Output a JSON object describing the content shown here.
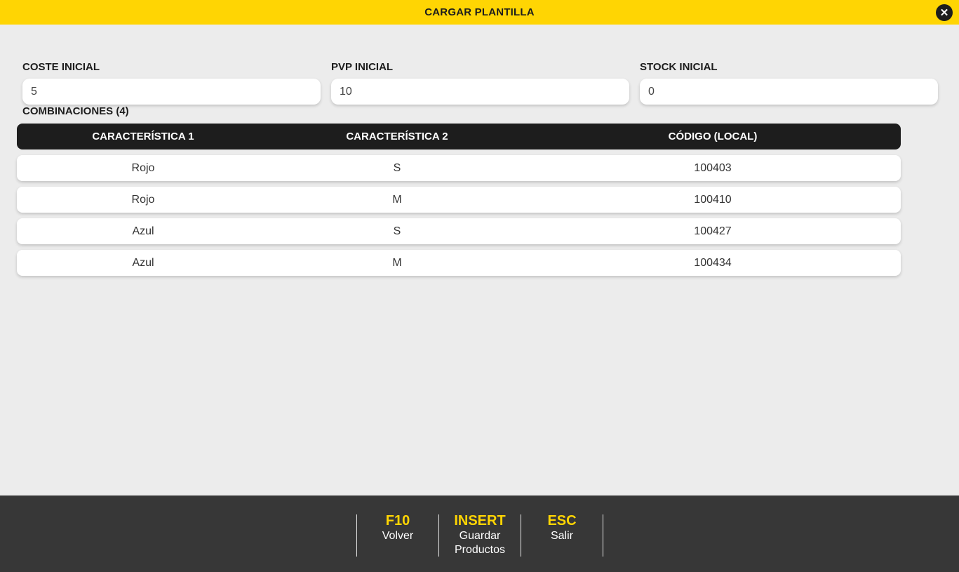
{
  "header": {
    "title": "CARGAR PLANTILLA",
    "close_symbol": "✕"
  },
  "fields": {
    "coste": {
      "label": "COSTE INICIAL",
      "value": "5"
    },
    "pvp": {
      "label": "PVP INICIAL",
      "value": "10"
    },
    "stock": {
      "label": "STOCK INICIAL",
      "value": "0"
    }
  },
  "combinations": {
    "label": "COMBINACIONES (4)",
    "columns": [
      "CARACTERÍSTICA 1",
      "CARACTERÍSTICA 2",
      "CÓDIGO (LOCAL)"
    ],
    "rows": [
      [
        "Rojo",
        "S",
        "100403"
      ],
      [
        "Rojo",
        "M",
        "100410"
      ],
      [
        "Azul",
        "S",
        "100427"
      ],
      [
        "Azul",
        "M",
        "100434"
      ]
    ]
  },
  "footer": {
    "keys": [
      {
        "key": "F10",
        "action": "Volver"
      },
      {
        "key": "INSERT",
        "action": "Guardar Productos"
      },
      {
        "key": "ESC",
        "action": "Salir"
      }
    ]
  },
  "colors": {
    "accent": "#ffd503",
    "dark": "#1d1d1d",
    "footer": "#373737",
    "background": "#ececec"
  }
}
